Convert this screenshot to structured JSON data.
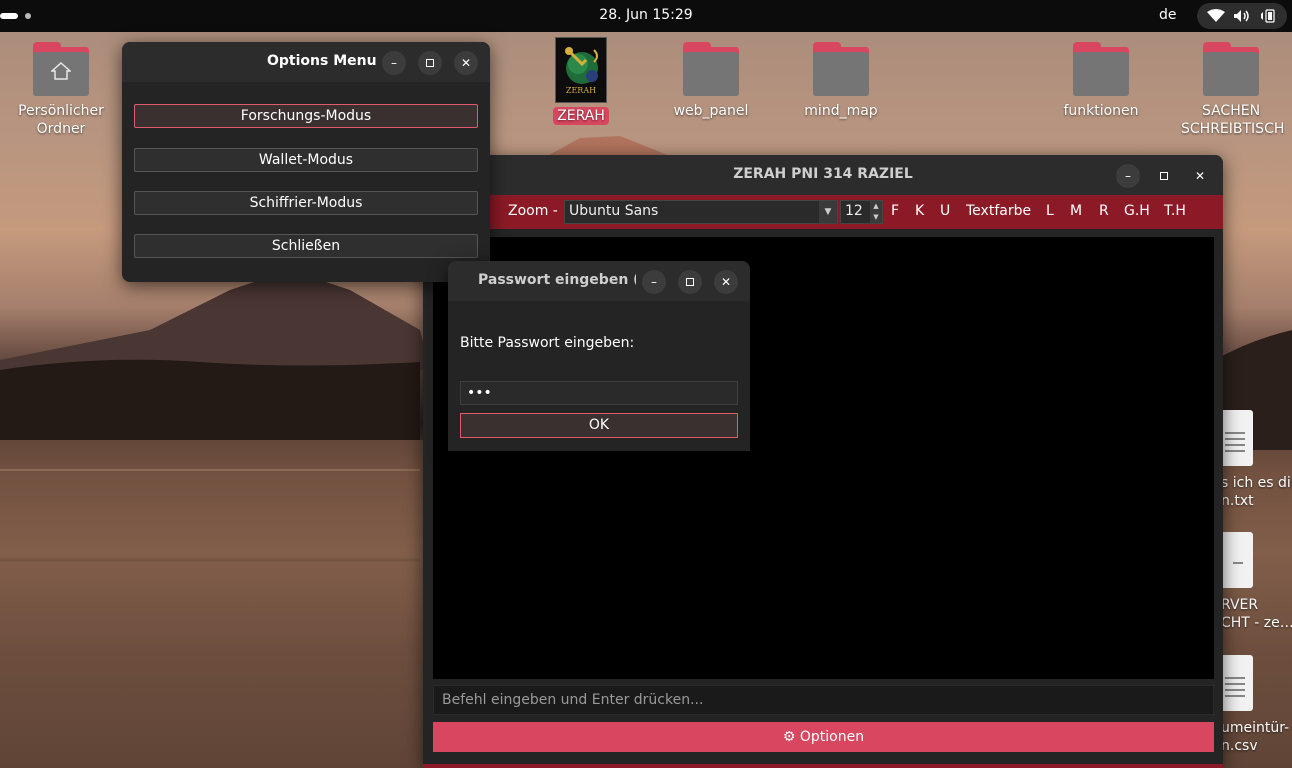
{
  "topbar": {
    "clock": "28. Jun  15:29",
    "language": "de"
  },
  "desktop": {
    "icons": [
      {
        "label": "Persönlicher Ordner",
        "icon": "home-folder-icon"
      },
      {
        "label": "ZERAH",
        "icon": "zerah-app-icon"
      },
      {
        "label": "web_panel",
        "icon": "folder-icon"
      },
      {
        "label": "mind_map",
        "icon": "folder-icon"
      },
      {
        "label": "funktionen",
        "icon": "folder-icon"
      },
      {
        "label": "SACHEN SCHREIBTISCH",
        "icon": "folder-icon"
      }
    ],
    "files": [
      {
        "line1": "s ich es dir",
        "line2": "n.txt"
      },
      {
        "line1": "RVER",
        "line2": "CHT - ze…"
      },
      {
        "line1": "umeintür-",
        "line2": "n.csv"
      }
    ],
    "zerah_logo_text": "ZERAH"
  },
  "options_menu": {
    "title": "Options Menu",
    "buttons": [
      "Forschungs-Modus",
      "Wallet-Modus",
      "Schiffrier-Modus",
      "Schließen"
    ]
  },
  "main_window": {
    "title": "ZERAH PNI 314 RAZIEL",
    "toolbar": {
      "dash": "-",
      "zoom": "Zoom -",
      "font": "Ubuntu Sans",
      "size": "12",
      "bold": "F",
      "italic": "K",
      "underline": "U",
      "text_color": "Textfarbe",
      "left": "L",
      "middle": "M",
      "right": "R",
      "gh": "G.H",
      "th": "T.H"
    },
    "command_placeholder": "Befehl eingeben und Enter drücken...",
    "options_button": "⚙ Optionen"
  },
  "password_dialog": {
    "title": "Passwort eingeben (Sc",
    "prompt": "Bitte Passwort eingeben:",
    "value": "•••",
    "ok_label": "OK"
  },
  "colors": {
    "accent": "#d8475f",
    "toolbar": "#8b1a26",
    "window_bg": "#242424",
    "titlebar": "#2c2c2c"
  }
}
